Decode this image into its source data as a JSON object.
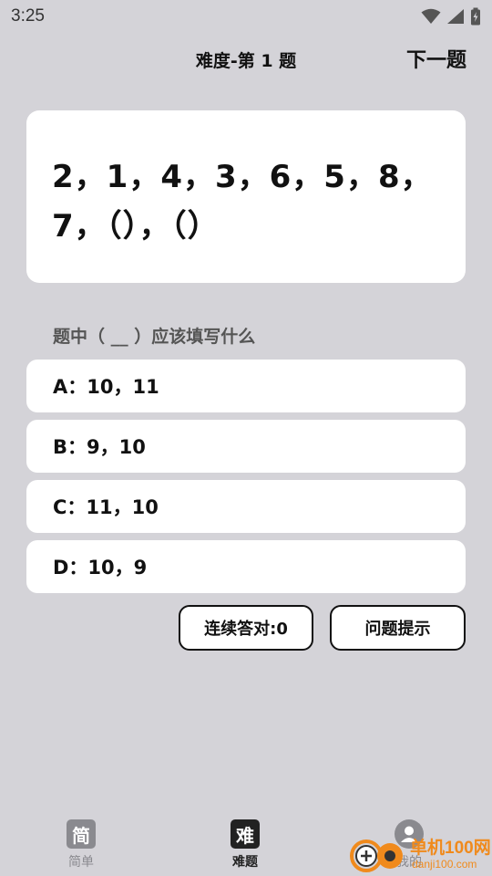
{
  "status_bar": {
    "time": "3:25",
    "icons": [
      "wifi-icon",
      "signal-icon",
      "battery-icon"
    ]
  },
  "header": {
    "title": "难度-第 1 题",
    "next_label": "下一题"
  },
  "question": {
    "line1": "2，1，4，3，6，5，8，",
    "line2": "7，（），（）"
  },
  "prompt": "题中（ __ ）应该填写什么",
  "options": [
    {
      "label": "A：10，11"
    },
    {
      "label": "B：9，10"
    },
    {
      "label": "C：11，10"
    },
    {
      "label": "D：10，9"
    }
  ],
  "actions": {
    "streak_label": "连续答对:0",
    "hint_label": "问题提示"
  },
  "bottom_nav": {
    "items": [
      {
        "icon_char": "简",
        "label": "简单",
        "active": false
      },
      {
        "icon_char": "难",
        "label": "难题",
        "active": true
      },
      {
        "icon_char": "",
        "label": "我的",
        "active": false
      }
    ]
  },
  "watermark": {
    "text1": "单机100网",
    "text2": "danji100.com"
  },
  "colors": {
    "background": "#d4d3d8",
    "card": "#ffffff",
    "text": "#111111",
    "muted": "#555555",
    "nav_inactive": "#8a8a8f",
    "nav_active": "#222222",
    "watermark_orange": "#f08a1c"
  }
}
